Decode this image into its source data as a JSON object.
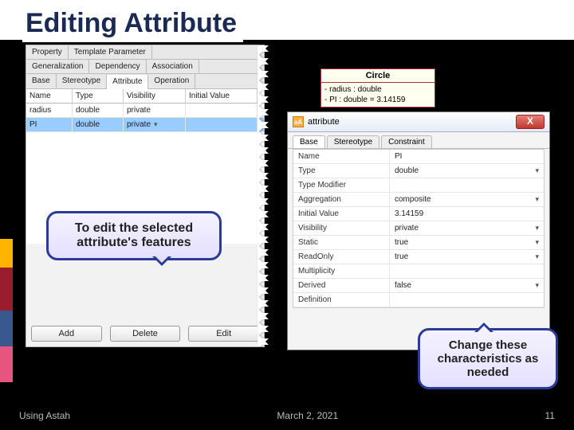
{
  "title": "Editing Attribute",
  "left_panel": {
    "tabs_r1": [
      "Property",
      "Template Parameter"
    ],
    "tabs_r2": [
      "Generalization",
      "Dependency",
      "Association"
    ],
    "tabs_r3": [
      "Base",
      "Stereotype",
      "Attribute",
      "Operation"
    ],
    "active_tab": "Attribute",
    "headers": [
      "Name",
      "Type",
      "Visibility",
      "Initial Value"
    ],
    "rows": [
      {
        "name": "radius",
        "type": "double",
        "vis": "private",
        "init": ""
      },
      {
        "name": "PI",
        "type": "double",
        "vis": "private",
        "init": ""
      }
    ],
    "buttons": {
      "add": "Add",
      "delete": "Delete",
      "edit": "Edit"
    }
  },
  "uml": {
    "class_name": "Circle",
    "attr1": "- radius : double",
    "attr2": "- PI : double = 3.14159"
  },
  "dialog": {
    "title": "attribute",
    "tabs": [
      "Base",
      "Stereotype",
      "Constraint"
    ],
    "active_tab": "Base",
    "props": [
      {
        "label": "Name",
        "value": "PI"
      },
      {
        "label": "Type",
        "value": "double"
      },
      {
        "label": "Type Modifier",
        "value": ""
      },
      {
        "label": "Aggregation",
        "value": "composite"
      },
      {
        "label": "Initial Value",
        "value": "3.14159"
      },
      {
        "label": "Visibility",
        "value": "private"
      },
      {
        "label": "Static",
        "value": "true"
      },
      {
        "label": "ReadOnly",
        "value": "true"
      },
      {
        "label": "Multiplicity",
        "value": ""
      },
      {
        "label": "Derived",
        "value": "false"
      },
      {
        "label": "Definition",
        "value": ""
      }
    ],
    "close": "Close"
  },
  "callouts": {
    "c1": "To edit the selected attribute's features",
    "c2": "Change these characteristics as needed"
  },
  "footer": {
    "left": "Using Astah",
    "date": "March 2, 2021",
    "page": "11"
  }
}
